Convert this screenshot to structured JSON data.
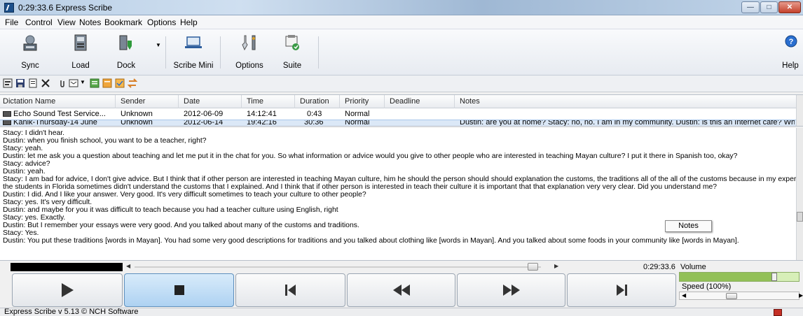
{
  "window": {
    "title": "0:29:33.6 Express Scribe",
    "min": "—",
    "max": "□",
    "close": "✕"
  },
  "menu": [
    "File",
    "Control",
    "View",
    "Notes",
    "Bookmark",
    "Options",
    "Help"
  ],
  "toolbar": {
    "sync": "Sync",
    "load": "Load",
    "dock": "Dock",
    "scribe_mini": "Scribe Mini",
    "options": "Options",
    "suite": "Suite",
    "help": "Help"
  },
  "list": {
    "columns": [
      "Dictation Name",
      "Sender",
      "Date",
      "Time",
      "Duration",
      "Priority",
      "Deadline",
      "Notes"
    ],
    "rows": [
      [
        "Echo  Sound Test Service...",
        "Unknown",
        "2012-06-09",
        "14:12:41",
        "0:43",
        "Normal",
        "",
        ""
      ],
      [
        "Kanik-Thursday-14 June",
        "Unknown",
        "2012-06-14",
        "19:42:16",
        "30:36",
        "Normal",
        "",
        "Dustin: are you at home? Stacy: no, no. I am in my community. Dustin: is this an Internet café? Where"
      ]
    ]
  },
  "transcript": [
    "Stacy: I didn't hear.",
    "Dustin: when you finish school, you want to be a teacher, right?",
    "Stacy: yeah.",
    "Dustin: let me ask you a question about teaching and let me put it in the chat for you. So what information or advice would you give to other people who are interested in teaching Mayan culture? I put it there in Spanish too, okay?",
    "Stacy: advice?",
    "Dustin: yeah.",
    "Stacy: I am bad for advice, I don't give advice. But I think that if other person are interested in teaching Mayan culture, him he should the person should should explanation the customs, the traditions all of the all of the customs because in my experience",
    "the students in Florida sometimes didn't understand the customs that I explained. And I think that if other person is interested in teach their culture it is important that that explanation very very clear. Did you understand me?",
    "Dustin: I did. And I like your answer. Very good. It's very difficult sometimes to teach your culture to other people?",
    "Stacy: yes. It's very difficult.",
    "Dustin: and maybe for you it was difficult to teach because you had a teacher culture using English, right",
    "Stacy: yes. Exactly.",
    "Dustin:  But I remember your essays were very good. And you talked about many of the customs and traditions.",
    "Stacy: Yes.",
    "Dustin: You put these traditions [words in Mayan]. You had some very good descriptions for traditions and you talked about clothing like [words in Mayan]. And you talked about some foods in your community like [words in Mayan]."
  ],
  "notes_tooltip": "Notes",
  "position_time": "0:29:33.6",
  "volume_label": "Volume",
  "volume_level": 0.77,
  "speed_label": "Speed (100%)",
  "status": "Express Scribe v 5.13 © NCH Software",
  "colors": {
    "accent": "#aed2f2",
    "volume": "#92c057"
  }
}
